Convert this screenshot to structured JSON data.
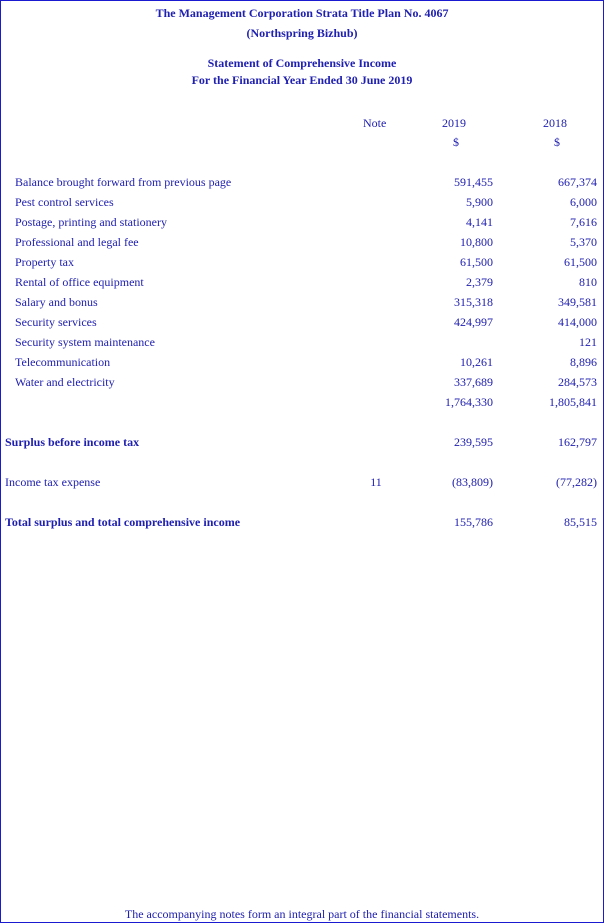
{
  "header": {
    "line1": "The Management Corporation Strata Title Plan No. 4067",
    "line2": "(Northspring Bizhub)",
    "line3": "Statement of Comprehensive Income",
    "line4": "For the Financial Year Ended 30 June 2019"
  },
  "columns": {
    "note": "Note",
    "y2019": "2019",
    "y2018": "2018",
    "cur2019": "$",
    "cur2018": "$"
  },
  "rows": [
    {
      "label": "Balance brought forward from previous page",
      "v2019": "591,455",
      "v2018": "667,374"
    },
    {
      "label": "Pest control services",
      "v2019": "5,900",
      "v2018": "6,000"
    },
    {
      "label": "Postage, printing and stationery",
      "v2019": "4,141",
      "v2018": "7,616"
    },
    {
      "label": "Professional and legal fee",
      "v2019": "10,800",
      "v2018": "5,370"
    },
    {
      "label": "Property tax",
      "v2019": "61,500",
      "v2018": "61,500"
    },
    {
      "label": "Rental of office equipment",
      "v2019": "2,379",
      "v2018": "810"
    },
    {
      "label": "Salary and bonus",
      "v2019": "315,318",
      "v2018": "349,581"
    },
    {
      "label": "Security services",
      "v2019": "424,997",
      "v2018": "414,000"
    },
    {
      "label": "Security system maintenance",
      "v2019": "",
      "v2018": "121"
    },
    {
      "label": "Telecommunication",
      "v2019": "10,261",
      "v2018": "8,896"
    },
    {
      "label": "Water and electricity",
      "v2019": "337,689",
      "v2018": "284,573"
    }
  ],
  "totals": {
    "v2019": "1,764,330",
    "v2018": "1,805,841"
  },
  "surplus_before_tax": {
    "label": "Surplus before income tax",
    "v2019": "239,595",
    "v2018": "162,797"
  },
  "income_tax": {
    "label": "Income tax expense",
    "note": "11",
    "v2019": "(83,809)",
    "v2018": "(77,282)"
  },
  "total_surplus": {
    "label": "Total surplus and total comprehensive income",
    "v2019": "155,786",
    "v2018": "85,515"
  },
  "footer": "The accompanying notes form an integral part of the financial statements."
}
